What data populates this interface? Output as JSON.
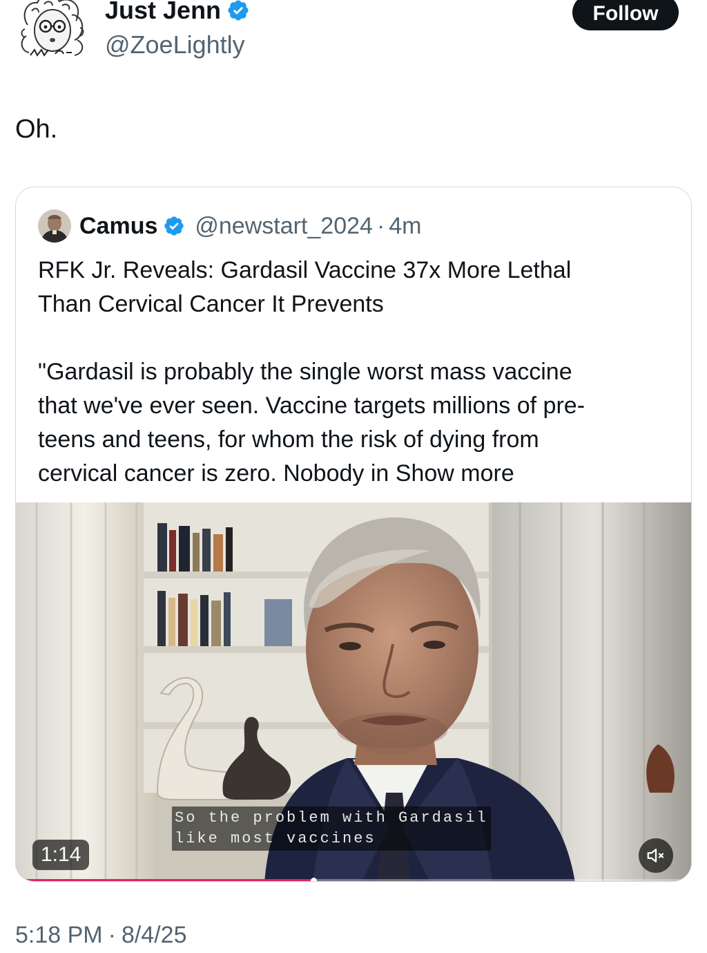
{
  "author": {
    "name": "Just Jenn",
    "handle": "@ZoeLightly",
    "verified": true,
    "avatar_icon": "cartoon-glasses-avatar-icon"
  },
  "follow_label": "Follow",
  "tweet_text": "Oh.",
  "quoted_tweet": {
    "name": "Camus",
    "handle": "@newstart_2024",
    "separator": "·",
    "time": "4m",
    "verified": true,
    "body_lines": [
      "RFK Jr. Reveals: Gardasil Vaccine 37x More Lethal",
      "Than Cervical Cancer It Prevents"
    ],
    "body_lines_2": [
      "\"Gardasil  is probably the single worst  mass vaccine",
      "that we've ever seen. Vaccine targets millions of pre-",
      "teens and teens, for whom the risk of dying from"
    ],
    "body_last_line": "cervical cancer is zero. Nobody in",
    "show_more_label": "Show more",
    "video": {
      "caption_line_1": "So the problem with Gardasil",
      "caption_line_2": "like most vaccines",
      "duration": "1:14",
      "muted": true,
      "progress": 0.44
    }
  },
  "timestamp": {
    "time": "5:18 PM",
    "separator": "·",
    "date": "8/4/25"
  },
  "colors": {
    "text": "#0f1419",
    "secondary": "#536471",
    "verified_blue": "#1d9bf0",
    "follow_bg": "#0f1419",
    "progress_red": "#e0245e"
  }
}
